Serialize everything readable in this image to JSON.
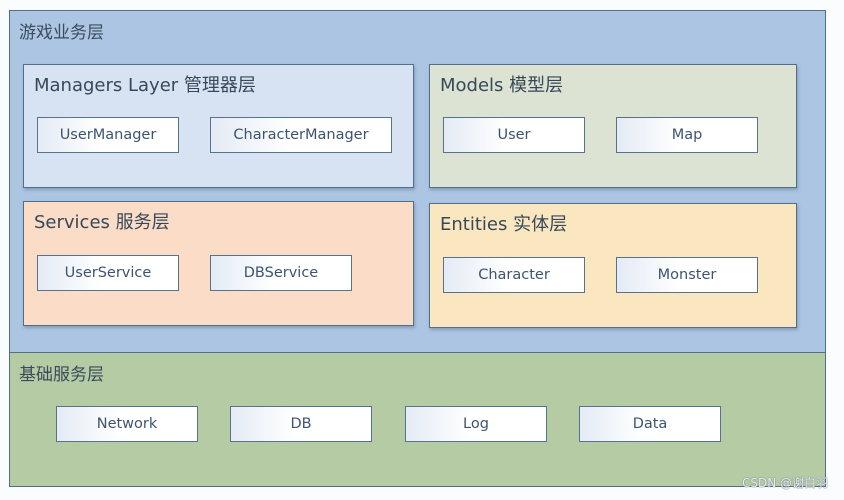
{
  "diagram": {
    "game_business_layer": {
      "title": "游戏业务层",
      "panels": {
        "managers": {
          "title": "Managers Layer 管理器层",
          "items": [
            "UserManager",
            "CharacterManager"
          ]
        },
        "models": {
          "title": "Models 模型层",
          "items": [
            "User",
            "Map"
          ]
        },
        "services": {
          "title": "Services 服务层",
          "items": [
            "UserService",
            "DBService"
          ]
        },
        "entities": {
          "title": "Entities 实体层",
          "items": [
            "Character",
            "Monster"
          ]
        }
      }
    },
    "foundation_layer": {
      "title": "基础服务层",
      "items": [
        "Network",
        "DB",
        "Log",
        "Data"
      ]
    }
  },
  "colors": {
    "game_business_layer": "#abc5e3",
    "foundation_layer": "#b5cba3",
    "managers": "#d7e3f2",
    "models": "#dce3d2",
    "services": "#fbdcc7",
    "entities": "#fbe7bf",
    "border": "#4f6f8a"
  },
  "watermark": "CSDN @谢白羽"
}
